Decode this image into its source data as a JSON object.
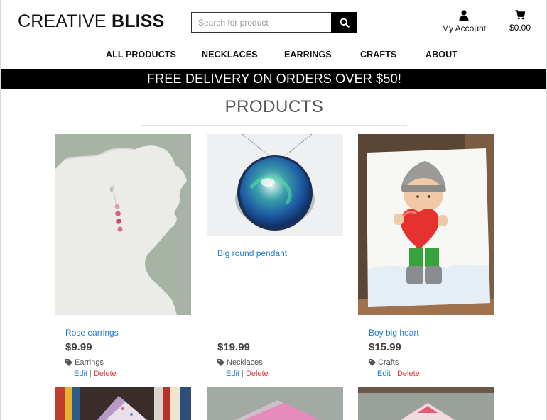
{
  "brand": {
    "part1": "CREATIVE",
    "part2": "BLISS"
  },
  "search": {
    "placeholder": "Search for product"
  },
  "account": {
    "label": "My Account"
  },
  "bag": {
    "total": "$0.00"
  },
  "nav": {
    "items": [
      "ALL PRODUCTS",
      "NECKLACES",
      "EARRINGS",
      "CRAFTS",
      "ABOUT"
    ]
  },
  "banner": {
    "text": "FREE DELIVERY ON ORDERS OVER $50!"
  },
  "page": {
    "title": "PRODUCTS"
  },
  "products": [
    {
      "name": "Rose earrings",
      "price": "$9.99",
      "category": "Earrings",
      "edit": "Edit",
      "sep": "|",
      "delete": "Delete"
    },
    {
      "name": "Big round pendant",
      "price": "$19.99",
      "category": "Necklaces",
      "edit": "Edit",
      "sep": "|",
      "delete": "Delete"
    },
    {
      "name": "Boy big heart",
      "price": "$15.99",
      "category": "Crafts",
      "edit": "Edit",
      "sep": "|",
      "delete": "Delete"
    }
  ],
  "colors": {
    "link": "#1e7bd6",
    "delete": "#e0363b",
    "banner_bg": "#000000"
  }
}
